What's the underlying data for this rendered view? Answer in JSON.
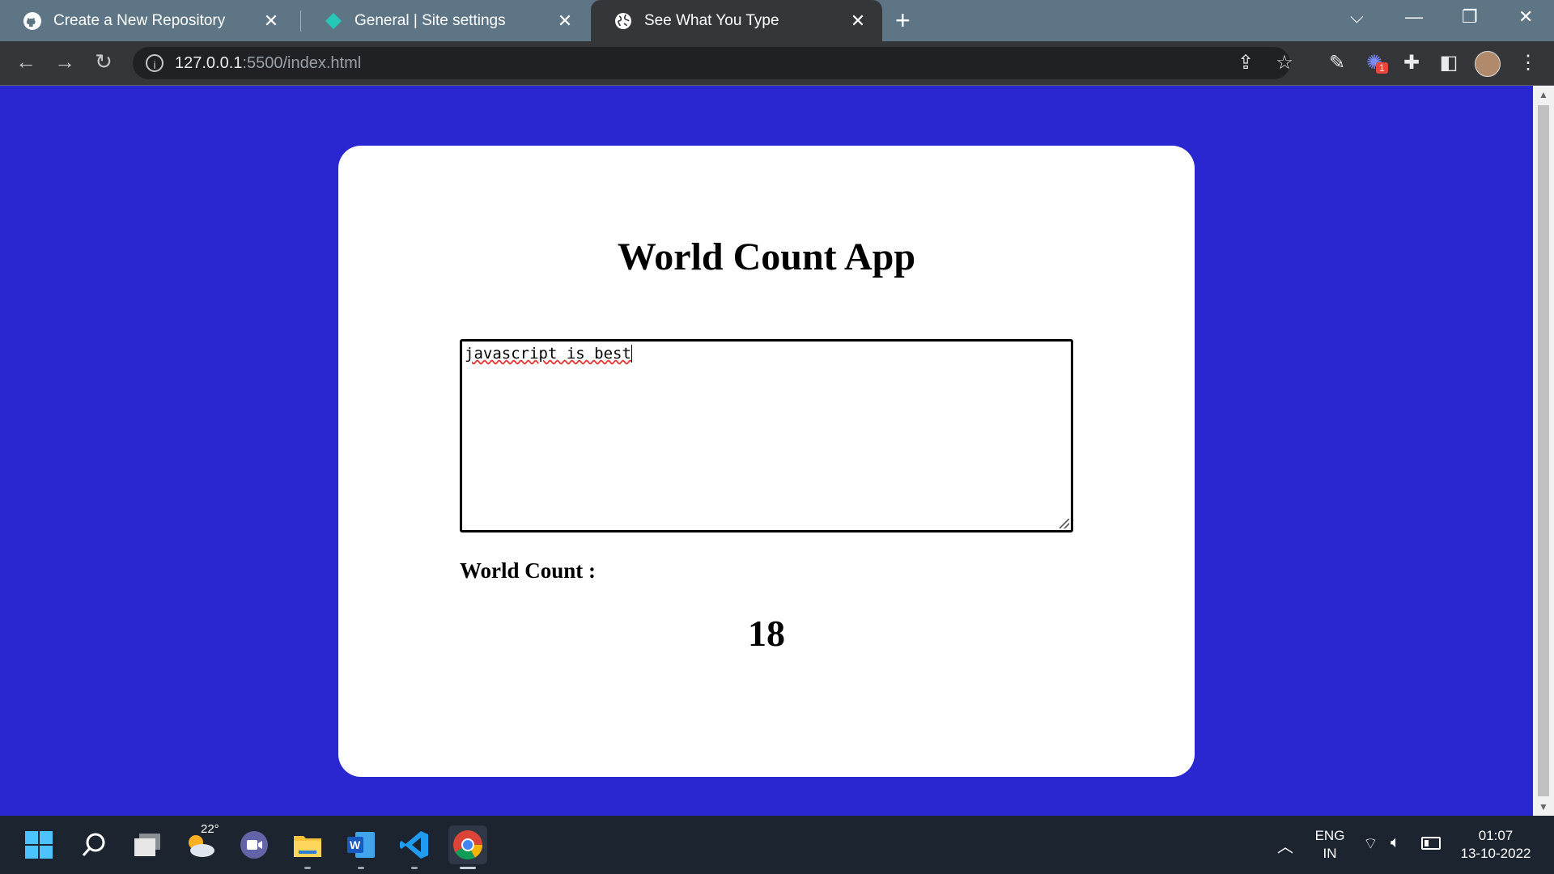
{
  "browser": {
    "tabs": [
      {
        "title": "Create a New Repository",
        "icon": "github-icon",
        "active": false
      },
      {
        "title": "General | Site settings",
        "icon": "netlify-icon",
        "active": false
      },
      {
        "title": "See What You Type",
        "icon": "globe-icon",
        "active": true
      }
    ],
    "url": {
      "host": "127.0.0.1",
      "path": ":5500/index.html"
    },
    "extension_badge": "1"
  },
  "page": {
    "title": "World Count App",
    "textarea_value": "javascript is best",
    "count_label": "World Count :",
    "count_value": "18"
  },
  "taskbar": {
    "weather_temp": "22°",
    "apps": [
      "start",
      "search",
      "task-view",
      "weather",
      "meet",
      "file-explorer",
      "word",
      "vscode",
      "chrome"
    ],
    "lang_line1": "ENG",
    "lang_line2": "IN",
    "time": "01:07",
    "date": "13-10-2022"
  },
  "colors": {
    "page_background": "#2a27d0",
    "card": "#ffffff",
    "tabstrip": "#5d7584",
    "toolbar": "#35363a"
  }
}
